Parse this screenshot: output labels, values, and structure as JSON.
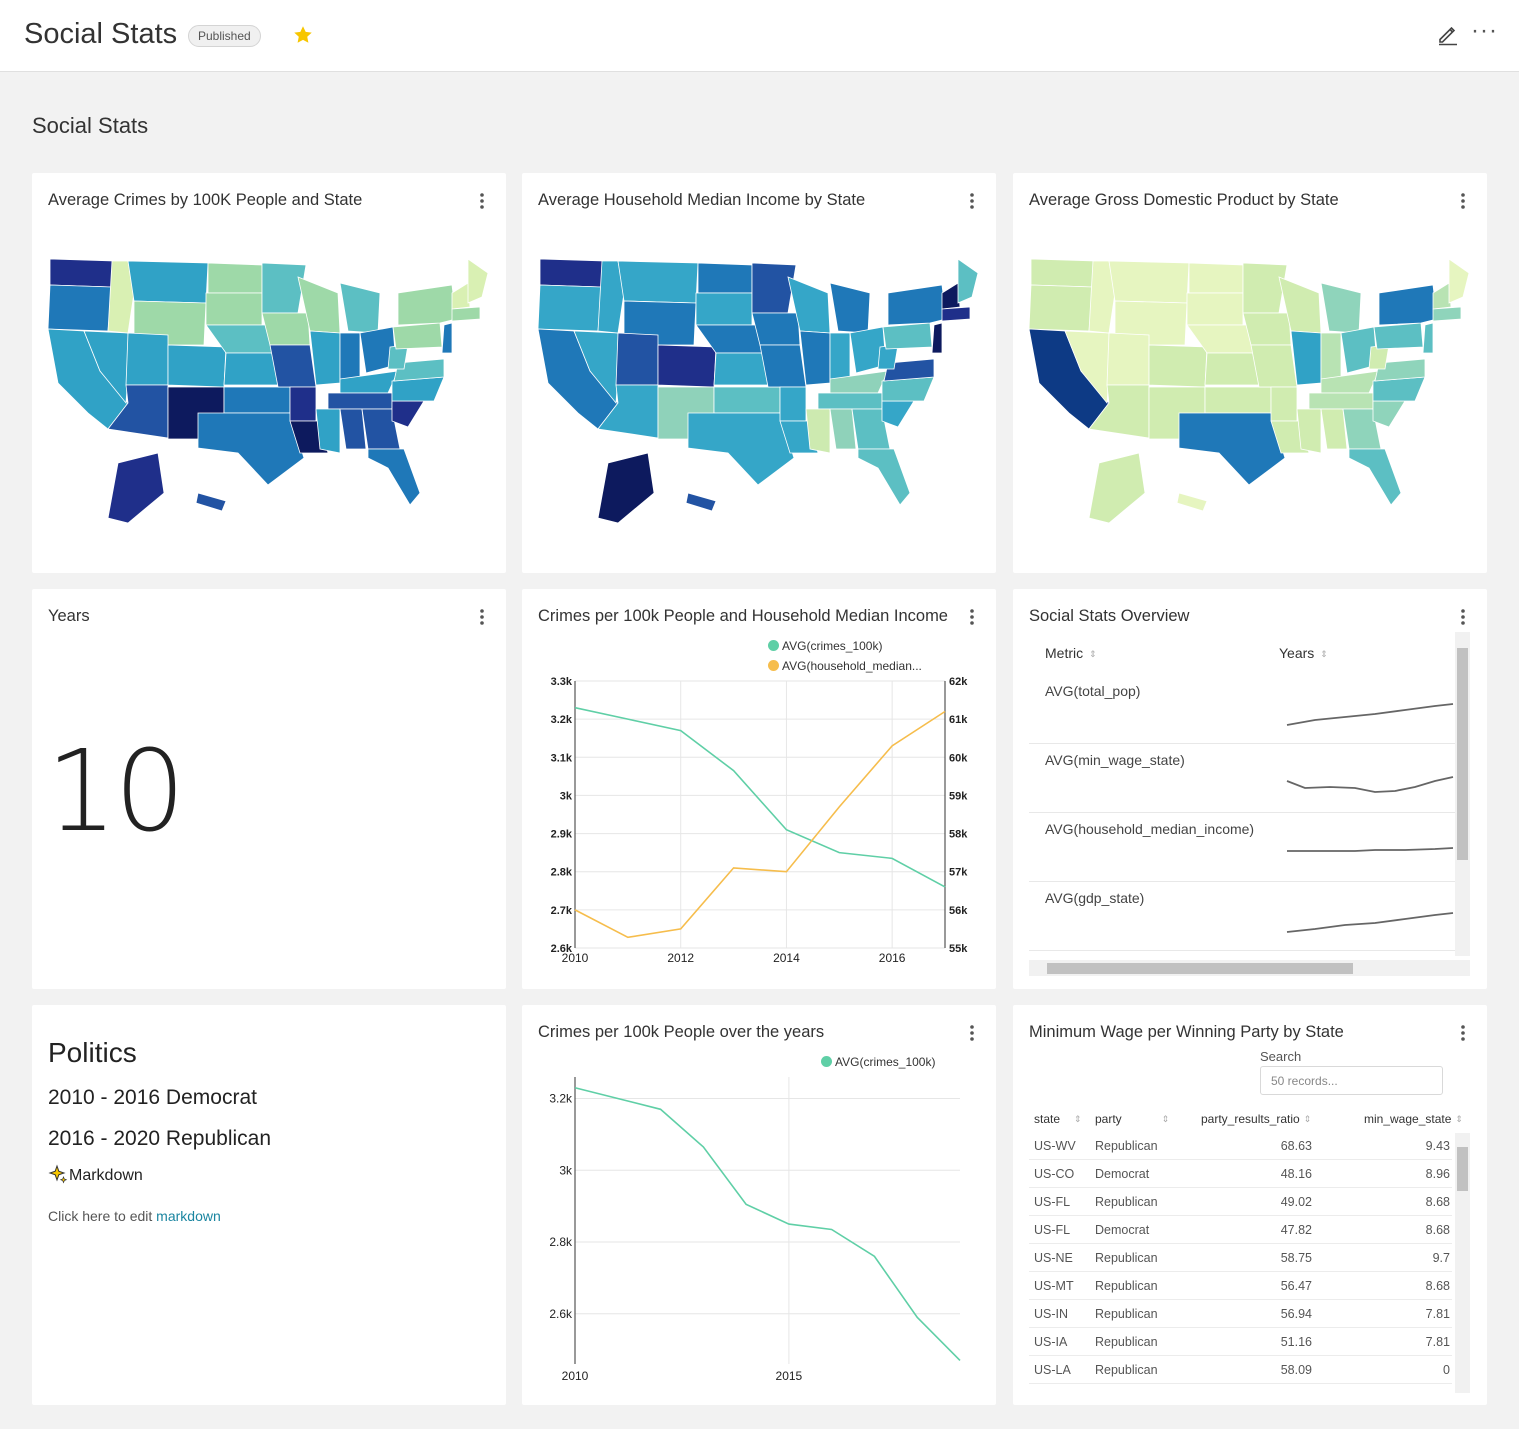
{
  "header": {
    "title": "Social Stats",
    "status_badge": "Published"
  },
  "dashboard": {
    "title": "Social Stats"
  },
  "maps": [
    {
      "title": "Average Crimes by 100K People and State"
    },
    {
      "title": "Average Household Median Income by State"
    },
    {
      "title": "Average Gross Domestic Product by State"
    }
  ],
  "years_card": {
    "title": "Years",
    "value": "10"
  },
  "dual_chart": {
    "title": "Crimes per 100k People and Household Median Income",
    "legend": [
      "AVG(crimes_100k)",
      "AVG(household_median..."
    ],
    "left_ticks": [
      "3.3k",
      "3.2k",
      "3.1k",
      "3k",
      "2.9k",
      "2.8k",
      "2.7k",
      "2.6k"
    ],
    "right_ticks": [
      "62k",
      "61k",
      "60k",
      "59k",
      "58k",
      "57k",
      "56k",
      "55k"
    ],
    "x_ticks": [
      "2010",
      "2012",
      "2014",
      "2016"
    ]
  },
  "overview": {
    "title": "Social Stats Overview",
    "col_metric": "Metric",
    "col_years": "Years",
    "rows": [
      {
        "metric": "AVG(total_pop)"
      },
      {
        "metric": "AVG(min_wage_state)"
      },
      {
        "metric": "AVG(household_median_income)"
      },
      {
        "metric": "AVG(gdp_state)"
      }
    ]
  },
  "markdown": {
    "h1": "Politics",
    "line1": "2010 - 2016 Democrat",
    "line2": "2016 - 2020 Republican",
    "line3": "Markdown",
    "edit_prefix": "Click here to edit ",
    "edit_link": "markdown"
  },
  "crime_chart": {
    "title": "Crimes per 100k People over the years",
    "legend": "AVG(crimes_100k)",
    "y_ticks": [
      "3.2k",
      "3k",
      "2.8k",
      "2.6k"
    ],
    "x_ticks": [
      "2010",
      "2015"
    ]
  },
  "wage_table": {
    "title": "Minimum Wage per Winning Party by State",
    "search_label": "Search",
    "search_placeholder": "50 records...",
    "columns": [
      "state",
      "party",
      "party_results_ratio",
      "min_wage_state"
    ],
    "rows": [
      [
        "US-WV",
        "Republican",
        "68.63",
        "9.43"
      ],
      [
        "US-CO",
        "Democrat",
        "48.16",
        "8.96"
      ],
      [
        "US-FL",
        "Republican",
        "49.02",
        "8.68"
      ],
      [
        "US-FL",
        "Democrat",
        "47.82",
        "8.68"
      ],
      [
        "US-NE",
        "Republican",
        "58.75",
        "9.7"
      ],
      [
        "US-MT",
        "Republican",
        "56.47",
        "8.68"
      ],
      [
        "US-IN",
        "Republican",
        "56.94",
        "7.81"
      ],
      [
        "US-IA",
        "Republican",
        "51.16",
        "7.81"
      ],
      [
        "US-LA",
        "Republican",
        "58.09",
        "0"
      ]
    ]
  },
  "chart_data": [
    {
      "type": "line",
      "title": "Crimes per 100k People and Household Median Income",
      "x": [
        2010,
        2011,
        2012,
        2013,
        2014,
        2015,
        2016,
        2017
      ],
      "xlim": [
        2010,
        2017
      ],
      "series": [
        {
          "name": "AVG(crimes_100k)",
          "axis": "left",
          "color": "#5fcfa6",
          "values": [
            3230,
            3200,
            3170,
            3065,
            2910,
            2850,
            2835,
            2760
          ]
        },
        {
          "name": "AVG(household_median...",
          "axis": "right",
          "color": "#f6bd4c",
          "values": [
            56000,
            55280,
            55500,
            57100,
            57000,
            58700,
            60300,
            61200
          ]
        }
      ],
      "ylim_left": [
        2600,
        3300
      ],
      "ylim_right": [
        55000,
        62000
      ],
      "grid": true,
      "legend": "top-right"
    },
    {
      "type": "line",
      "title": "Crimes per 100k People over the years",
      "x": [
        2010,
        2011,
        2012,
        2013,
        2014,
        2015,
        2016,
        2017,
        2018,
        2019
      ],
      "xlim": [
        2010,
        2019
      ],
      "series": [
        {
          "name": "AVG(crimes_100k)",
          "color": "#5fcfa6",
          "values": [
            3230,
            3200,
            3170,
            3065,
            2905,
            2850,
            2835,
            2760,
            2590,
            2470
          ]
        }
      ],
      "ylim": [
        2460,
        3260
      ],
      "grid": true,
      "legend": "top-right"
    }
  ],
  "colors": {
    "crimes": "#5fcfa6",
    "income": "#f6bd4c",
    "star": "#f7c600",
    "link": "#1a85a0"
  },
  "icons": [
    "star-icon",
    "edit-icon",
    "more-icon",
    "kebab-icon",
    "sparkles-icon",
    "sort-icon"
  ]
}
